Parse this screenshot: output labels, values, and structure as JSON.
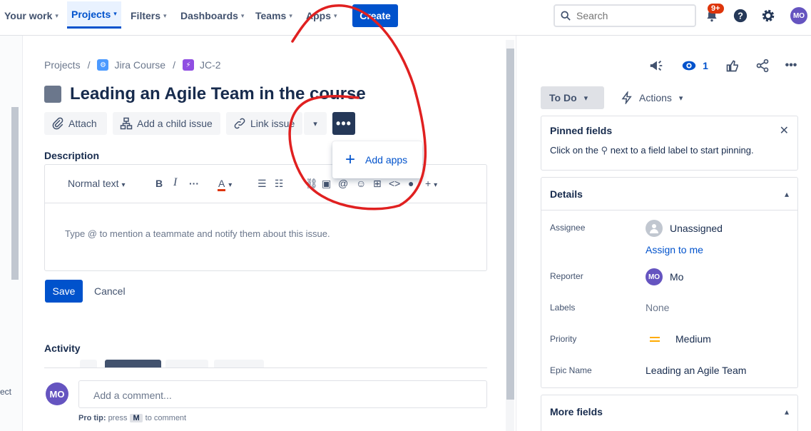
{
  "nav": {
    "items": [
      {
        "label": "Your work"
      },
      {
        "label": "Projects"
      },
      {
        "label": "Filters"
      },
      {
        "label": "Dashboards"
      },
      {
        "label": "Teams"
      },
      {
        "label": "Apps"
      }
    ],
    "create_label": "Create",
    "search_placeholder": "Search",
    "notification_badge": "9+",
    "user_initials": "MO"
  },
  "sidebar": {
    "cut_text": "ect"
  },
  "breadcrumb": {
    "project": "Projects",
    "course": "Jira Course",
    "issue_key": "JC-2"
  },
  "issue": {
    "title": "Leading an Agile Team in the course"
  },
  "toolbar": {
    "attach": "Attach",
    "add_child": "Add a child issue",
    "link_issue": "Link issue",
    "more": "•••"
  },
  "dropdown": {
    "add_apps": "Add apps"
  },
  "description": {
    "label": "Description",
    "style_select": "Normal text",
    "placeholder": "Type @ to mention a teammate and notify them about this issue.",
    "save": "Save",
    "cancel": "Cancel"
  },
  "activity": {
    "label": "Activity",
    "comment_placeholder": "Add a comment...",
    "avatar": "MO",
    "pro_tip_label": "Pro tip:",
    "pro_tip_press": "press",
    "pro_tip_key": "M",
    "pro_tip_rest": "to comment"
  },
  "right": {
    "watch_count": "1",
    "status": "To Do",
    "actions": "Actions",
    "pinned": {
      "title": "Pinned fields",
      "text_before": "Click on the",
      "text_after": "next to a field label to start pinning."
    },
    "details": {
      "title": "Details",
      "assignee_label": "Assignee",
      "assignee_value": "Unassigned",
      "assign_to_me": "Assign to me",
      "reporter_label": "Reporter",
      "reporter_value": "Mo",
      "reporter_initials": "MO",
      "labels_label": "Labels",
      "labels_value": "None",
      "priority_label": "Priority",
      "priority_value": "Medium",
      "epic_label": "Epic Name",
      "epic_value": "Leading an Agile Team"
    },
    "more_fields": "More fields"
  },
  "colors": {
    "brand": "#0052cc",
    "avatar": "#6554c0",
    "annotation": "#e02020",
    "priority": "#ffab00"
  }
}
